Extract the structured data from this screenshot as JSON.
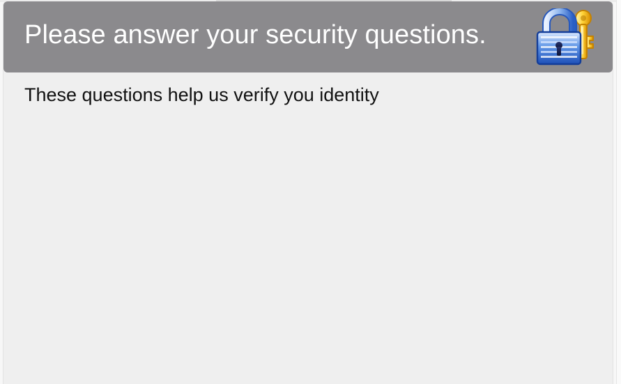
{
  "header": {
    "title": "Please answer your security questions.",
    "icon": "lock-and-key-icon"
  },
  "body": {
    "subtitle": "These questions help us verify you identity"
  },
  "colors": {
    "header_background": "#8b8a8d",
    "panel_background": "#efefef",
    "title_text": "#ffffff",
    "body_text": "#111111"
  }
}
